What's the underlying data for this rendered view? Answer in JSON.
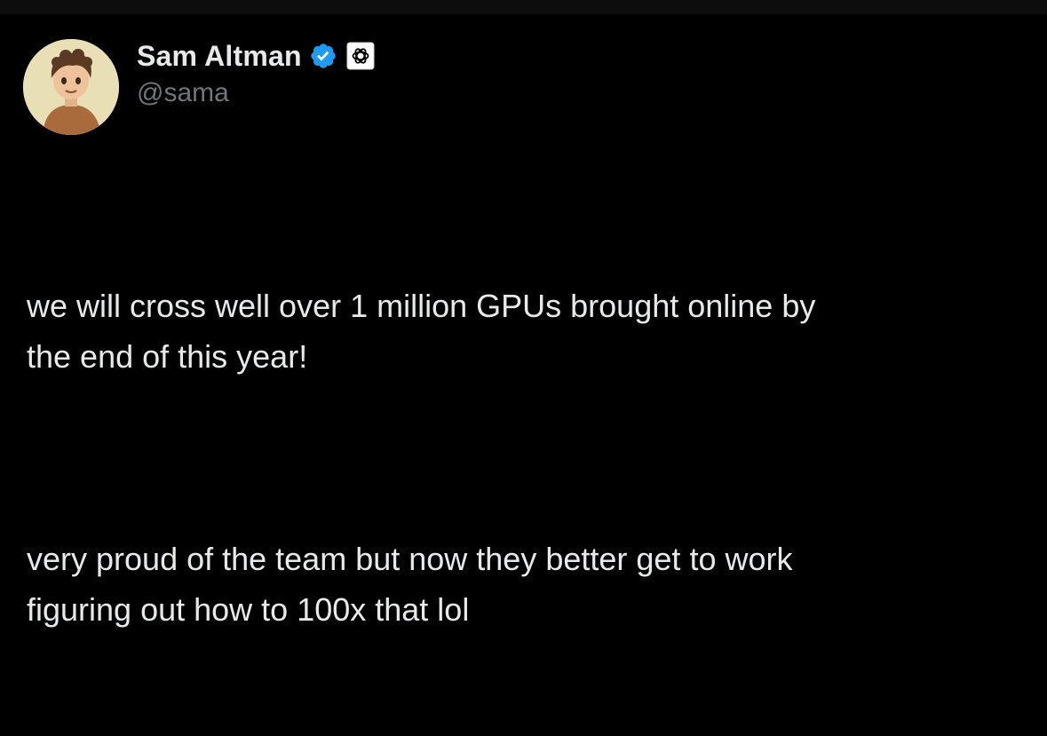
{
  "tweet": {
    "author": {
      "display_name": "Sam Altman",
      "handle": "@sama",
      "avatar_icon": "cartoon-avatar-icon",
      "badges": [
        "verified-badge-icon",
        "openai-affiliate-icon"
      ]
    },
    "paragraphs": [
      "we will cross well over 1 million GPUs brought online by\nthe end of this year!",
      "very proud of the team but now they better get to work\nfiguring out how to 100x that lol"
    ]
  },
  "colors": {
    "background": "#000000",
    "text_primary": "#e7e9ea",
    "text_secondary": "#71767b",
    "verified_blue": "#1d9bf0"
  }
}
